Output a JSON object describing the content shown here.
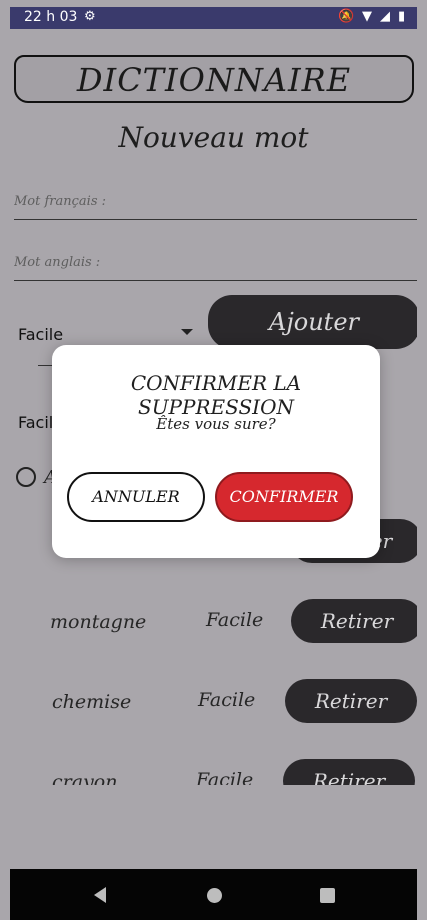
{
  "status_bar": {
    "time": "22 h 03"
  },
  "app": {
    "title": "DICTIONNAIRE",
    "subtitle": "Nouveau mot",
    "fields": {
      "french_placeholder": "Mot français :",
      "english_placeholder": "Mot anglais :"
    },
    "difficulty_select": {
      "value": "Facile"
    },
    "add_button": "Ajouter",
    "filter_label": "Facile",
    "radio_text": "A",
    "words": [
      {
        "word": "montagne",
        "level": "Facile",
        "action": "Retirer"
      },
      {
        "word": "chemise",
        "level": "Facile",
        "action": "Retirer"
      },
      {
        "word": "crayon",
        "level": "Facile",
        "action": "Retirer"
      }
    ],
    "partial_button": "Retirer"
  },
  "dialog": {
    "title": "CONFIRMER LA SUPPRESSION",
    "message": "Êtes vous sure?",
    "cancel": "ANNULER",
    "confirm": "CONFIRMER",
    "colors": {
      "confirm_bg": "#d6282e",
      "confirm_border": "#8f1a1e"
    }
  }
}
